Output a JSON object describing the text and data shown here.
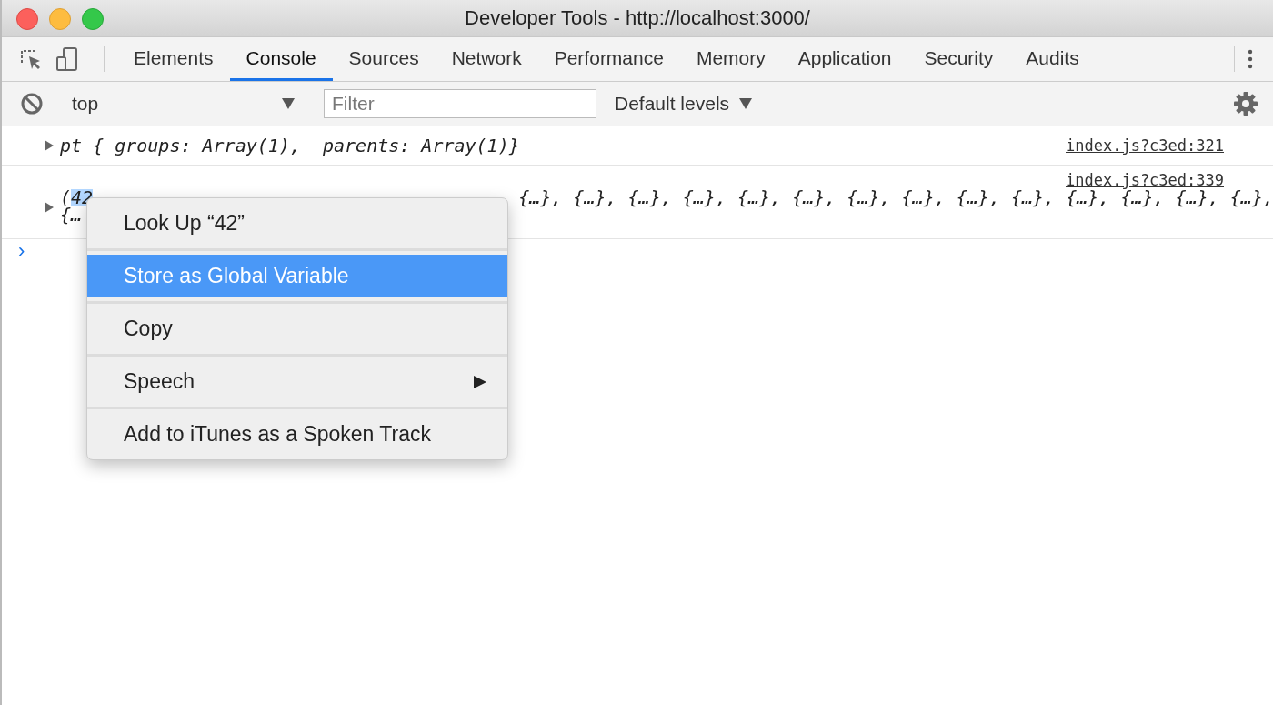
{
  "window": {
    "title": "Developer Tools - http://localhost:3000/"
  },
  "tabs": [
    {
      "label": "Elements",
      "selected": false
    },
    {
      "label": "Console",
      "selected": true
    },
    {
      "label": "Sources",
      "selected": false
    },
    {
      "label": "Network",
      "selected": false
    },
    {
      "label": "Performance",
      "selected": false
    },
    {
      "label": "Memory",
      "selected": false
    },
    {
      "label": "Application",
      "selected": false
    },
    {
      "label": "Security",
      "selected": false
    },
    {
      "label": "Audits",
      "selected": false
    }
  ],
  "filter_bar": {
    "context": "top",
    "filter": {
      "placeholder": "Filter"
    },
    "levels": "Default levels"
  },
  "console": {
    "messages": [
      {
        "kind": "object",
        "text": "pt {_groups: Array(1), _parents: Array(1)}",
        "source": "index.js?c3ed:321"
      },
      {
        "kind": "array",
        "prefix": "(",
        "highlight": "42",
        "tail": "{…}, {…}, {…}, {…}, {…}, {…}, {…}, {…}, {…}, {…}, {…}, {…}, {…}, {…},",
        "line2": "{…",
        "source": "index.js?c3ed:339"
      }
    ],
    "prompt": "›"
  },
  "context_menu": {
    "items": [
      {
        "label": "Look Up “42”",
        "selected": false,
        "submenu": false
      },
      {
        "label": "Store as Global Variable",
        "selected": true,
        "submenu": false
      },
      {
        "label": "Copy",
        "selected": false,
        "submenu": false
      },
      {
        "label": "Speech",
        "selected": false,
        "submenu": true
      },
      {
        "label": "Add to iTunes as a Spoken Track",
        "selected": false,
        "submenu": false
      }
    ]
  }
}
